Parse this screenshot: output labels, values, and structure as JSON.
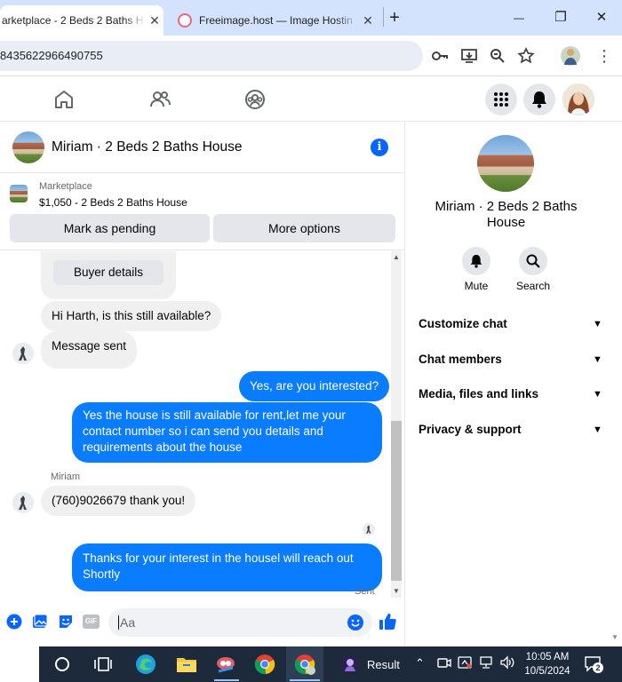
{
  "browser": {
    "tabs": [
      {
        "title": "arketplace - 2 Beds 2 Baths H",
        "active": true
      },
      {
        "title": "Freeimage.host — Image Hostin",
        "active": false
      }
    ],
    "new_tab": "+",
    "address": "84356229664907 55",
    "address_text": "8435622966490755",
    "window": {
      "minimize": "—",
      "restore": "❐",
      "close": "✕"
    }
  },
  "facebook": {
    "header_icons": [
      "home-icon",
      "friends-icon",
      "groups-icon",
      "menu-icon",
      "notifications-icon",
      "profile-avatar"
    ]
  },
  "conversation": {
    "title": "Miriam · 2 Beds 2 Baths House",
    "marketplace": {
      "label": "Marketplace",
      "listing": "$1,050 - 2 Beds 2 Baths House"
    },
    "buttons": {
      "mark_pending": "Mark as pending",
      "more_options": "More options"
    },
    "buyer_details": "Buyer details",
    "messages": [
      {
        "from": "buyer",
        "text": "Hi Harth, is this still available?"
      },
      {
        "from": "buyer",
        "text": "Message sent"
      },
      {
        "from": "me",
        "text": "Yes, are you interested?"
      },
      {
        "from": "me",
        "text": "Yes the house is still available for rent,let me your contact number so i can send you details and requirements about the house"
      },
      {
        "from": "buyer",
        "sender": "Miriam",
        "text": "(760)9026679 thank you!"
      },
      {
        "from": "me",
        "text": "Thanks for your interest in the housel will reach out Shortly"
      }
    ],
    "status": "Sent",
    "composer_placeholder": "Aa"
  },
  "info_panel": {
    "name": "Miriam · 2 Beds 2 Baths House",
    "actions": [
      {
        "label": "Mute",
        "icon": "bell-icon"
      },
      {
        "label": "Search",
        "icon": "search-icon"
      }
    ],
    "sections": [
      "Customize chat",
      "Chat members",
      "Media, files and links",
      "Privacy & support"
    ]
  },
  "taskbar": {
    "result_label": "Result",
    "time": "10:05 AM",
    "date": "10/5/2024",
    "notifications": "2"
  },
  "colors": {
    "accent": "#0a7cff",
    "info": "#0866ff",
    "taskbar": "#1c2a3c",
    "tabstrip": "#d3e3fd"
  }
}
